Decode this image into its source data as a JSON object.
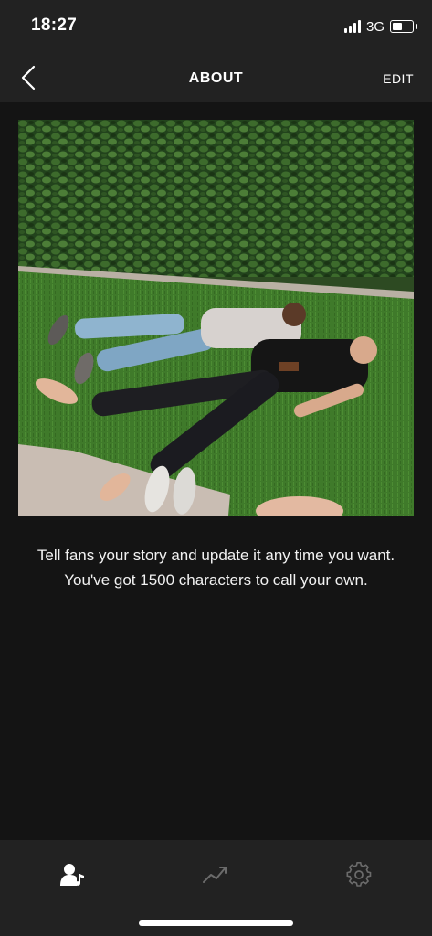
{
  "status_bar": {
    "time": "18:27",
    "network": "3G",
    "signal_icon": "signal-bars-icon",
    "battery_icon": "battery-icon",
    "battery_level": 0.4
  },
  "header": {
    "back_icon": "chevron-left-icon",
    "title": "ABOUT",
    "edit_label": "EDIT"
  },
  "photo": {
    "kind": "photo",
    "subject": "two people lying on grass in front of a hedge"
  },
  "about": {
    "text": "Tell fans your story and update it any time you want. You've got 1500 characters to call your own."
  },
  "tab_bar": {
    "items": [
      {
        "icon": "artist-profile-icon",
        "active": true
      },
      {
        "icon": "stats-trend-icon",
        "active": false
      },
      {
        "icon": "gear-icon",
        "active": false
      }
    ]
  },
  "colors": {
    "background": "#141414",
    "bars": "#222222",
    "text": "#ffffff",
    "inactive_icon": "#6b6b6b"
  }
}
